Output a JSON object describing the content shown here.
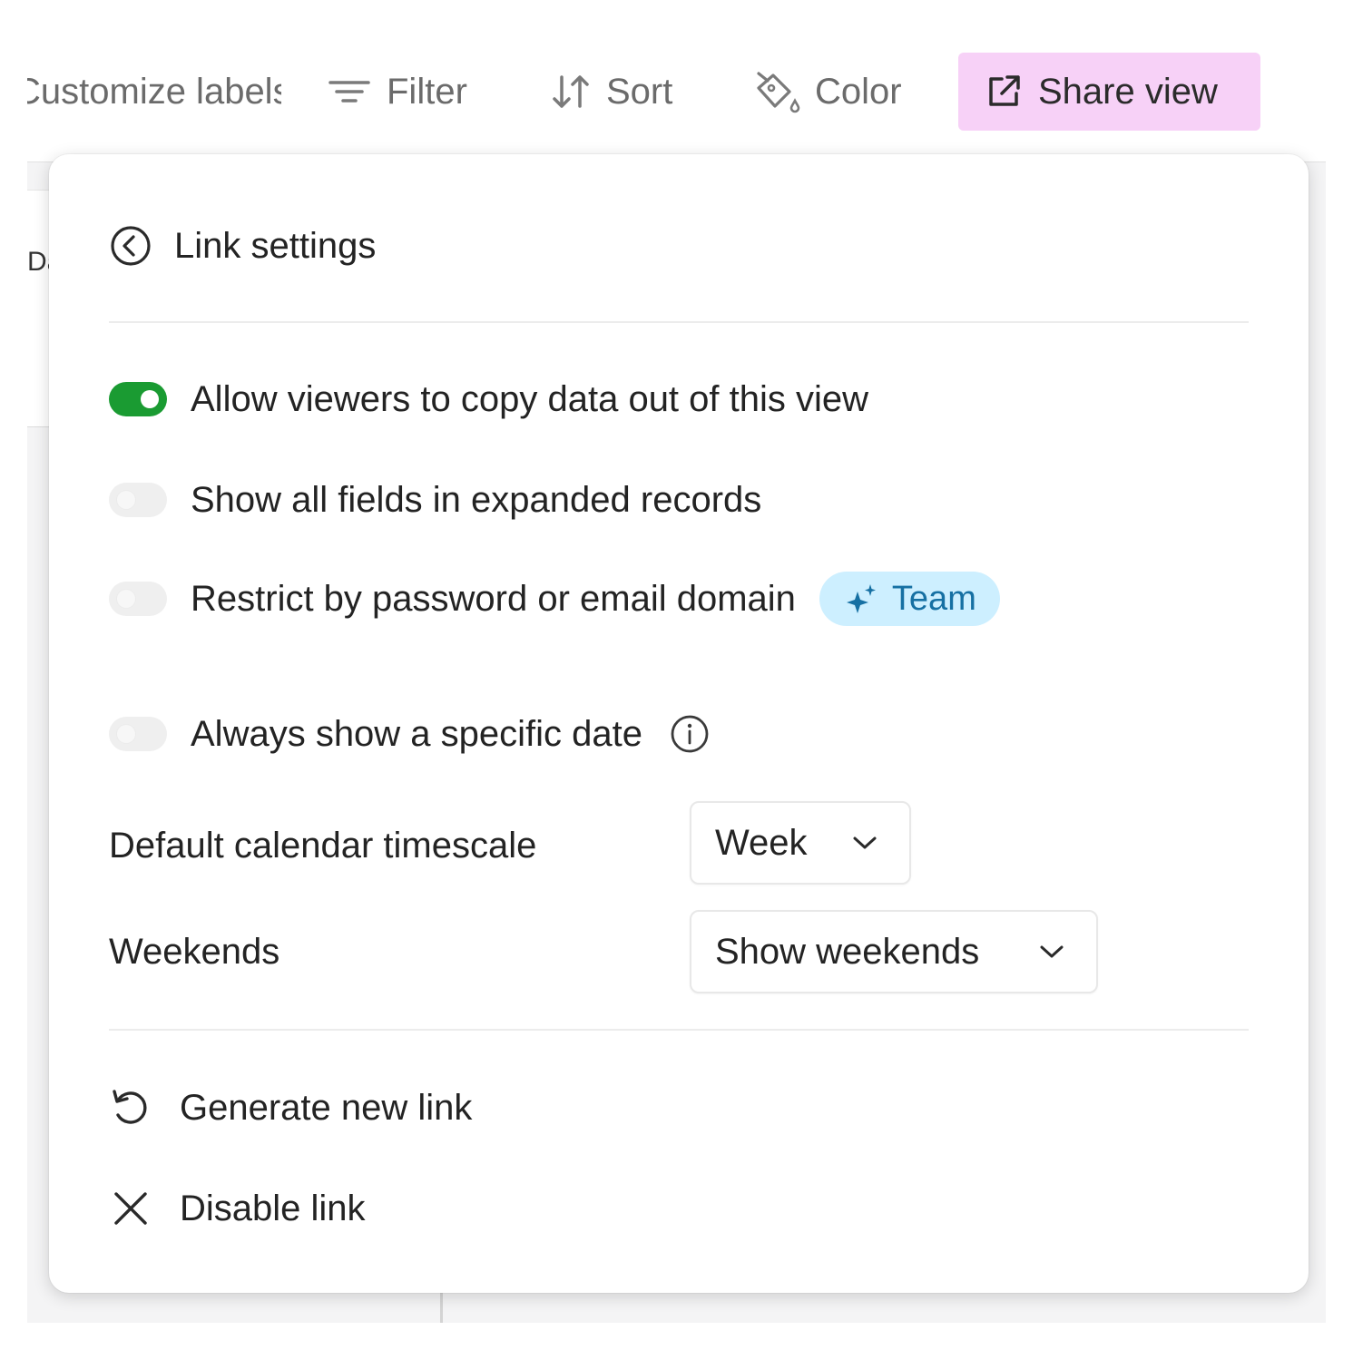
{
  "toolbar": {
    "customize_label": "Customize labels",
    "filter_label": "Filter",
    "sort_label": "Sort",
    "color_label": "Color",
    "share_label": "Share view"
  },
  "background": {
    "cell_text": "Day"
  },
  "popover": {
    "title": "Link settings",
    "toggles": [
      {
        "label": "Allow viewers to copy data out of this view",
        "on": true
      },
      {
        "label": "Show all fields in expanded records",
        "on": false
      },
      {
        "label": "Restrict by password or email domain",
        "on": false,
        "badge": "Team"
      },
      {
        "label": "Always show a specific date",
        "on": false
      }
    ],
    "settings": [
      {
        "label": "Default calendar timescale",
        "value": "Week"
      },
      {
        "label": "Weekends",
        "value": "Show weekends"
      }
    ],
    "actions": [
      {
        "label": "Generate new link",
        "icon": "refresh-icon"
      },
      {
        "label": "Disable link",
        "icon": "close-icon"
      }
    ]
  },
  "colors": {
    "share_bg": "#f7d1f7",
    "toggle_on": "#1a9b32",
    "toggle_off": "#efefef",
    "badge_bg": "#cdefff",
    "badge_text": "#1670a3"
  }
}
